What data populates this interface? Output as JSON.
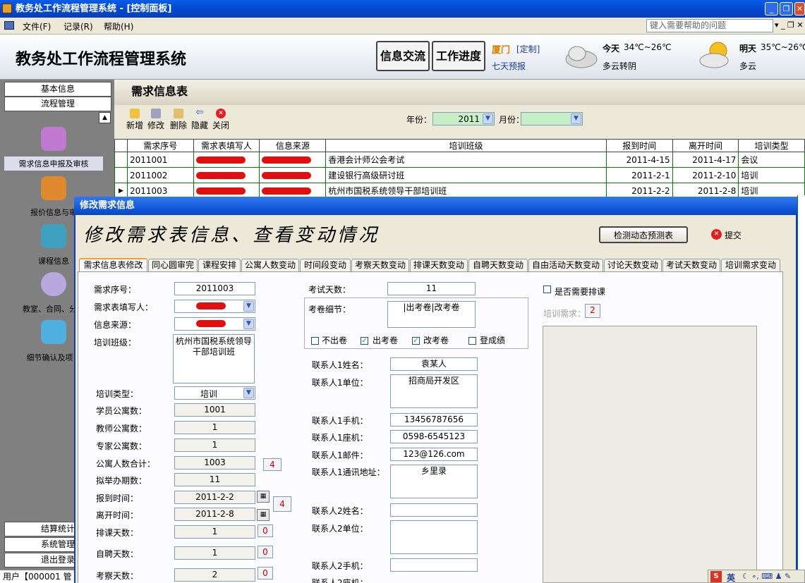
{
  "window": {
    "title": "教务处工作流程管理系统 - [控制面板]"
  },
  "menu": {
    "file": "文件(F)",
    "record": "记录(R)",
    "help": "帮助(H)",
    "help_placeholder": "键入需要帮助的问题"
  },
  "header": {
    "title": "教务处工作流程管理系统",
    "btn_info": "信息交流",
    "btn_progress": "工作进度",
    "city": "厦门",
    "customize": "[定制]",
    "forecast": "七天预报",
    "today_label": "今天",
    "today_temp": "34℃~26℃",
    "today_desc": "多云转阴",
    "tomorrow_label": "明天",
    "tomorrow_temp": "35℃~26℃",
    "tomorrow_desc": "多云"
  },
  "sidebar": {
    "basic": "基本信息",
    "process": "流程管理",
    "items": [
      "需求信息申报及审核",
      "报价信息与审",
      "课程信息",
      "教室、合同、分工",
      "细节确认及项目"
    ],
    "settlement": "结算统计",
    "system": "系统管理",
    "exit": "退出登录"
  },
  "status": {
    "user": "用户【000001 管理"
  },
  "section": {
    "title": "需求信息表"
  },
  "toolbar": {
    "add": "新增",
    "edit": "修改",
    "delete": "删除",
    "hide": "隐藏",
    "close": "关闭",
    "year_label": "年份：",
    "year_value": "2011",
    "month_label": "月份："
  },
  "grid": {
    "headers": [
      "需求序号",
      "需求表填写人",
      "信息来源",
      "培训班级",
      "报到时间",
      "离开时间",
      "培训类型"
    ],
    "rows": [
      {
        "id": "2011001",
        "class": "香港会计师公会考试",
        "start": "2011-4-15",
        "end": "2011-4-17",
        "type": "会议"
      },
      {
        "id": "2011002",
        "class": "建设银行高级研讨班",
        "start": "2011-2-1",
        "end": "2011-2-10",
        "type": "培训"
      },
      {
        "id": "2011003",
        "class": "杭州市国税系统领导干部培训班",
        "start": "2011-2-2",
        "end": "2011-2-8",
        "type": "培训"
      }
    ]
  },
  "dialog": {
    "title": "修改需求信息",
    "banner": "修改需求表信息、查看变动情况",
    "detect_btn": "检测动态预测表",
    "submit": "提交",
    "tabs": [
      "需求信息表修改",
      "同心圆审完",
      "课程安排",
      "公寓人数变动",
      "时间段变动",
      "考察天数变动",
      "排课天数变动",
      "自聘天数变动",
      "自由活动天数变动",
      "讨论天数变动",
      "考试天数变动",
      "培训需求变动"
    ]
  },
  "form": {
    "req_no_label": "需求序号：",
    "req_no": "2011003",
    "filler_label": "需求表填写人：",
    "source_label": "信息来源：",
    "class_label": "培训班级：",
    "class_value": "杭州市国税系统领导干部培训班",
    "type_label": "培训类型：",
    "type_value": "培训",
    "stu_label": "学员公寓数：",
    "stu_value": "1001",
    "tea_label": "教师公寓数：",
    "tea_value": "1",
    "exp_label": "专家公寓数：",
    "exp_value": "1",
    "total_label": "公寓人数合计：",
    "total_value": "1003",
    "total_badge": "4",
    "period_label": "拟举办期数：",
    "period_value": "11",
    "arrive_label": "报到时间：",
    "arrive_value": "2011-2-2",
    "date_badge": "4",
    "leave_label": "离开时间：",
    "leave_value": "2011-2-8",
    "course_label": "排课天数：",
    "course_value": "1",
    "course_badge": "0",
    "hire_label": "自聘天数：",
    "hire_value": "1",
    "hire_badge": "0",
    "visit_label": "考察天数：",
    "visit_value": "2",
    "visit_badge": "0",
    "exam_label": "考试天数：",
    "exam_value": "11",
    "paper_label": "考卷细节：",
    "paper_value": "|出考卷|改考卷",
    "opt_no": "不出卷",
    "opt_make": "出考卷",
    "opt_grade": "改考卷",
    "opt_score": "登成绩",
    "c1_name_label": "联系人1姓名：",
    "c1_name": "袁某人",
    "c1_unit_label": "联系人1单位：",
    "c1_unit": "招商局开发区",
    "c1_mobile_label": "联系人1手机：",
    "c1_mobile": "13456787656",
    "c1_phone_label": "联系人1座机：",
    "c1_phone": "0598-6545123",
    "c1_mail_label": "联系人1邮件：",
    "c1_mail": "123@126.com",
    "c1_addr_label": "联系人1通讯地址：",
    "c1_addr": "乡里录",
    "c2_name_label": "联系人2姓名：",
    "c2_unit_label": "联系人2单位：",
    "c2_mobile_label": "联系人2手机：",
    "c2_phone_label": "联系人2座机：",
    "need_schedule": "是否需要排课",
    "need_label": "培训需求：",
    "need_badge": "2"
  },
  "ime": {
    "label": "英"
  }
}
